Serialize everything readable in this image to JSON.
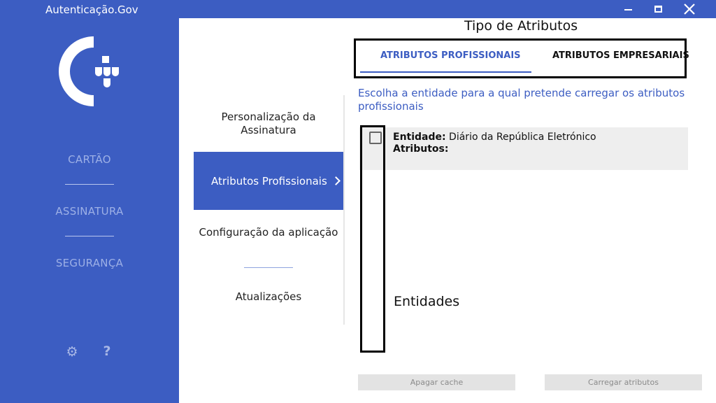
{
  "app": {
    "title": "Autenticação.Gov"
  },
  "window_controls": {
    "minimize": "—",
    "maximize": "□",
    "close": "✕"
  },
  "sidebar": {
    "logo": "autenticacao-gov-logo",
    "items": [
      {
        "label": "CARTÃO"
      },
      {
        "label": "ASSINATURA"
      },
      {
        "label": "SEGURANÇA"
      }
    ],
    "settings_icon": "gear-icon",
    "help_icon": "?"
  },
  "menu": {
    "items": [
      {
        "label": "Personalização da Assinatura"
      },
      {
        "label": "Atributos Profissionais"
      },
      {
        "label": "Configuração da aplicação"
      },
      {
        "label": "Atualizações"
      }
    ],
    "active_index": 1
  },
  "content": {
    "section_title": "Tipo de Atributos",
    "tabs": [
      {
        "label": "ATRIBUTOS PROFISSIONAIS",
        "active": true
      },
      {
        "label": "ATRIBUTOS EMPRESARIAIS",
        "active": false
      }
    ],
    "instruction": "Escolha a entidade para a qual pretende carregar os atributos profissionais",
    "entities": [
      {
        "entity_label": "Entidade:",
        "entity_value": " Diário da República Eletrónico",
        "attributes_label": "Atributos:",
        "checked": false
      }
    ],
    "entities_label": "Entidades",
    "buttons": {
      "clear_cache": "Apagar cache",
      "load_attributes": "Carregar atributos"
    }
  },
  "colors": {
    "brand_blue": "#3c5dc2",
    "sidebar_text": "#9db0e6",
    "panel_bg": "#ffffff",
    "row_bg": "#eeeeee",
    "button_bg": "#e3e3e3"
  }
}
